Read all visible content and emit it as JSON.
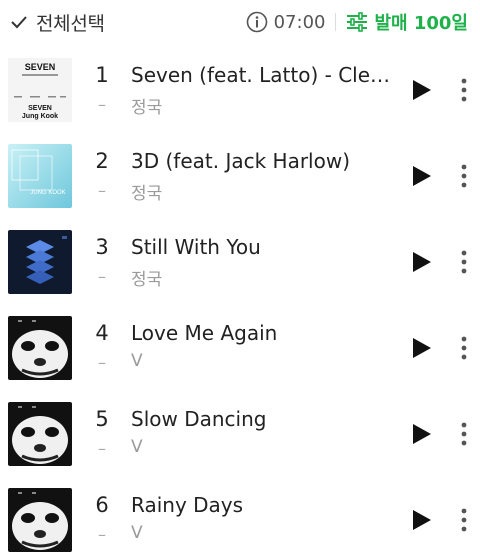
{
  "header": {
    "select_all_label": "전체선택",
    "time": "07:00",
    "sort_label": "발매 100일",
    "accent_color": "#1fb24a"
  },
  "tracks": [
    {
      "rank": "1",
      "dash": "–",
      "title": "Seven (feat. Latto) - Clean Ver.",
      "artist": "정국",
      "art_text_top": "SEVEN",
      "art_text_bottom": "Jung Kook"
    },
    {
      "rank": "2",
      "dash": "–",
      "title": "3D (feat. Jack Harlow)",
      "artist": "정국",
      "art_text": "JUNG KOOK"
    },
    {
      "rank": "3",
      "dash": "–",
      "title": "Still With You",
      "artist": "정국"
    },
    {
      "rank": "4",
      "dash": "–",
      "title": "Love Me Again",
      "artist": "V"
    },
    {
      "rank": "5",
      "dash": "–",
      "title": "Slow Dancing",
      "artist": "V"
    },
    {
      "rank": "6",
      "dash": "–",
      "title": "Rainy Days",
      "artist": "V"
    }
  ],
  "icons": {
    "check": "check-icon",
    "info": "info-icon",
    "sort": "sort-sliders-icon",
    "play": "play-icon",
    "more": "more-vertical-icon"
  }
}
